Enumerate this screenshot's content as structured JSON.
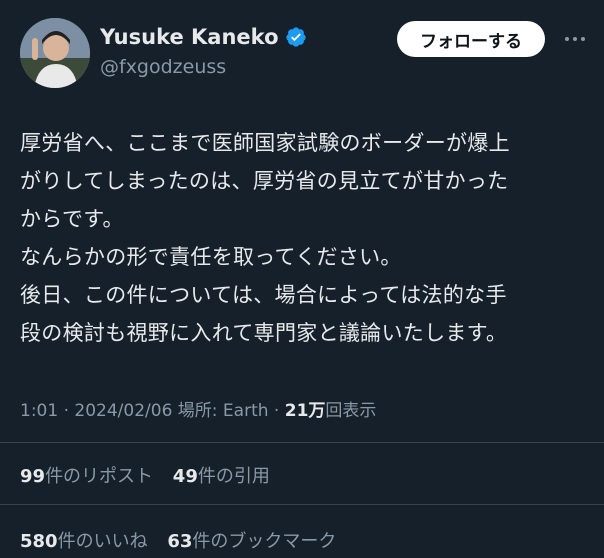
{
  "author": {
    "display_name": "Yusuke Kaneko",
    "handle": "@fxgodzeuss",
    "verified_icon": "verified-badge-icon",
    "avatar_icon": "avatar-photo"
  },
  "actions": {
    "follow_label": "フォローする",
    "more_icon": "more-options-icon"
  },
  "tweet": {
    "lines": [
      "厚労省へ、ここまで医師国家試験のボーダーが爆上",
      "がりしてしまったのは、厚労省の見立てが甘かった",
      "からです。",
      "なんらかの形で責任を取ってください。",
      "後日、この件については、場合によっては法的な手",
      "段の検討も視野に入れて専門家と議論いたします。"
    ]
  },
  "meta": {
    "time": "1:01",
    "separator": " · ",
    "date": "2024/02/06",
    "location": "場所: Earth",
    "views_count": "21万",
    "views_label": "回表示"
  },
  "stats": {
    "reposts_count": "99",
    "reposts_label": "件のリポスト",
    "quotes_count": "49",
    "quotes_label": "件の引用",
    "likes_count": "580",
    "likes_label": "件のいいね",
    "bookmarks_count": "63",
    "bookmarks_label": "件のブックマーク"
  },
  "colors": {
    "background": "#15202b",
    "text": "#e7e9ea",
    "muted": "#8b98a5",
    "verified": "#1d9bf0",
    "divider": "#38444d"
  }
}
